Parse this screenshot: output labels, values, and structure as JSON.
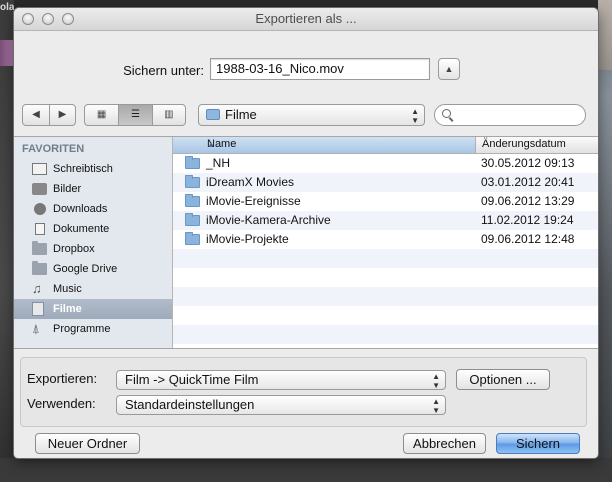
{
  "background": {
    "left_app_label": "olatnek"
  },
  "window": {
    "title": "Exportieren als ..."
  },
  "save": {
    "label": "Sichern unter:",
    "filename": "1988-03-16_Nico.mov"
  },
  "toolbar": {
    "location": "Filme",
    "search_value": ""
  },
  "sidebar": {
    "header": "FAVORITEN",
    "items": [
      {
        "label": "Schreibtisch",
        "icon": "desktop-icon",
        "selected": false
      },
      {
        "label": "Bilder",
        "icon": "camera-icon",
        "selected": false
      },
      {
        "label": "Downloads",
        "icon": "download-icon",
        "selected": false
      },
      {
        "label": "Dokumente",
        "icon": "document-icon",
        "selected": false
      },
      {
        "label": "Dropbox",
        "icon": "folder-icon",
        "selected": false
      },
      {
        "label": "Google Drive",
        "icon": "folder-icon",
        "selected": false
      },
      {
        "label": "Music",
        "icon": "music-note-icon",
        "selected": false
      },
      {
        "label": "Filme",
        "icon": "film-icon",
        "selected": true
      },
      {
        "label": "Programme",
        "icon": "apps-icon",
        "selected": false
      }
    ]
  },
  "files": {
    "col_name": "Name",
    "col_date": "Änderungsdatum",
    "rows": [
      {
        "name": "_NH",
        "date": "30.05.2012 09:13"
      },
      {
        "name": "iDreamX Movies",
        "date": "03.01.2012 20:41"
      },
      {
        "name": "iMovie-Ereignisse",
        "date": "09.06.2012 13:29"
      },
      {
        "name": "iMovie-Kamera-Archive",
        "date": "11.02.2012 19:24"
      },
      {
        "name": "iMovie-Projekte",
        "date": "09.06.2012 12:48"
      }
    ]
  },
  "options": {
    "export_label": "Exportieren:",
    "export_value": "Film -> QuickTime Film",
    "options_button": "Optionen ...",
    "use_label": "Verwenden:",
    "use_value": "Standardeinstellungen"
  },
  "buttons": {
    "new_folder": "Neuer Ordner",
    "cancel": "Abbrechen",
    "save": "Sichern"
  },
  "colors": {
    "accent": "#5a98e6",
    "sidebar_selection": "#a6b1c1",
    "folder": "#8ab4dc"
  }
}
